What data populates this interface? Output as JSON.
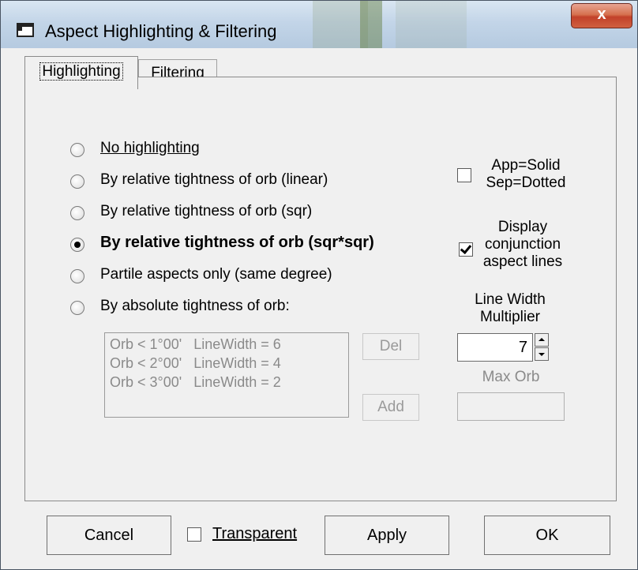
{
  "window": {
    "title": "Aspect Highlighting & Filtering",
    "close_symbol": "x"
  },
  "tabs": [
    {
      "label": "Highlighting",
      "active": true
    },
    {
      "label": "Filtering",
      "active": false
    }
  ],
  "highlighting": {
    "options": [
      {
        "label": "No highlighting",
        "selected": false
      },
      {
        "label": "By relative tightness of orb (linear)",
        "selected": false
      },
      {
        "label": "By relative tightness of orb (sqr)",
        "selected": false
      },
      {
        "label": "By relative tightness of orb (sqr*sqr)",
        "selected": true
      },
      {
        "label": "Partile aspects only (same degree)",
        "selected": false
      },
      {
        "label": "By absolute tightness of orb:",
        "selected": false
      }
    ],
    "orb_list": [
      {
        "orb": "Orb < 1°00'",
        "width": "LineWidth = 6"
      },
      {
        "orb": "Orb < 2°00'",
        "width": "LineWidth = 4"
      },
      {
        "orb": "Orb < 3°00'",
        "width": "LineWidth = 2"
      }
    ],
    "del_label": "Del",
    "add_label": "Add",
    "app_solid": {
      "line1": "App=Solid",
      "line2": "Sep=Dotted",
      "checked": false
    },
    "conjunction": {
      "line1": "Display",
      "line2": "conjunction",
      "line3": "aspect lines",
      "checked": true
    },
    "line_width": {
      "line1": "Line Width",
      "line2": "Multiplier",
      "value": "7"
    },
    "max_orb": {
      "label": "Max Orb",
      "value": ""
    }
  },
  "buttons": {
    "cancel": "Cancel",
    "transparent": "Transparent",
    "transparent_checked": false,
    "apply": "Apply",
    "ok": "OK"
  }
}
